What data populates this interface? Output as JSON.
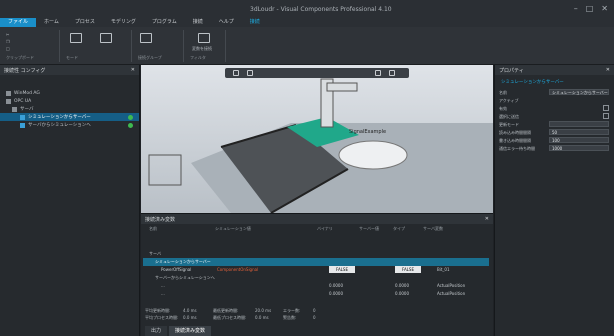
{
  "window": {
    "title": "3dLoudr - Visual Components Professional 4.10"
  },
  "menubar": {
    "items": [
      {
        "label": "ファイル",
        "active": true
      },
      {
        "label": "ホーム"
      },
      {
        "label": "プロセス"
      },
      {
        "label": "モデリング"
      },
      {
        "label": "プログラム"
      },
      {
        "label": "接続"
      },
      {
        "label": "ヘルプ"
      },
      {
        "label": "接続",
        "accent": true
      }
    ]
  },
  "ribbon": {
    "groups": [
      {
        "caption": "クリップボード"
      },
      {
        "caption": "モード"
      },
      {
        "caption": "接続グループ"
      },
      {
        "caption": "フィルタ"
      }
    ],
    "big_button_label": "変数を接続"
  },
  "left_panel": {
    "title": "接続性 コンフィグ",
    "tree": [
      {
        "label": "WinMod AG",
        "indent": 0
      },
      {
        "label": "OPC UA",
        "indent": 0
      },
      {
        "label": "サーバ",
        "indent": 1
      },
      {
        "label": "シミュレーションからサーバー",
        "indent": 2,
        "selected": true
      },
      {
        "label": "サーバからシミュレーションへ",
        "indent": 2
      }
    ]
  },
  "properties": {
    "title": "プロパティ",
    "subtitle": "シミュレーションからサーバー",
    "rows": [
      {
        "label": "名前",
        "value": "シミュレーションからサーバー"
      },
      {
        "label": "アクティブ",
        "value": ""
      },
      {
        "label": "有効",
        "check": true
      },
      {
        "label": "選択に送信",
        "value": ""
      },
      {
        "label": "更新モード",
        "value": ""
      },
      {
        "label": "読み込み時間間隔",
        "value": "50"
      },
      {
        "label": "書き込み時間間隔",
        "value": "100"
      },
      {
        "label": "通信エラー待ち時間",
        "value": "1000"
      }
    ]
  },
  "viewport": {
    "label": "SignalExample"
  },
  "signals": {
    "title": "接続済み変数",
    "columns": [
      "名前",
      "シミュレーション値",
      "バイナリ",
      "サーバー値",
      "タイプ",
      "サーバ変数"
    ],
    "rows": [
      {
        "name": "サーバ",
        "indent": 0
      },
      {
        "name": "シミュレーションからサーバー",
        "indent": 1,
        "selected": true
      },
      {
        "name": "PowerOffSignal",
        "indent": 2,
        "sim_value": "ComponentOnSignal",
        "sim_box": "FALSE",
        "server_box": "FALSE",
        "server_var": "Bit_01"
      },
      {
        "name": "サーバーからシミュレーションへ",
        "indent": 1
      },
      {
        "name": "...",
        "indent": 2,
        "sim_value": "0.0000",
        "server_value": "0.0000",
        "server_var": "ActualPosition"
      },
      {
        "name": "...",
        "indent": 2,
        "sim_value": "0.0000",
        "server_value": "0.0000",
        "server_var": "ActualPosition"
      }
    ],
    "footer": [
      {
        "label": "平均更新時間:",
        "value": "4.0 ms"
      },
      {
        "label": "最低更新時間:",
        "value": "20.0 ms"
      },
      {
        "label": "エラー数:",
        "value": "0"
      },
      {
        "label": "平均プロセス時間:",
        "value": "0.0 ms"
      },
      {
        "label": "最低プロセス時間:",
        "value": "0.0 ms"
      },
      {
        "label": "警告数:",
        "value": "0"
      }
    ],
    "tabs": [
      {
        "label": "出力"
      },
      {
        "label": "接続済み変数",
        "active": true
      }
    ]
  }
}
